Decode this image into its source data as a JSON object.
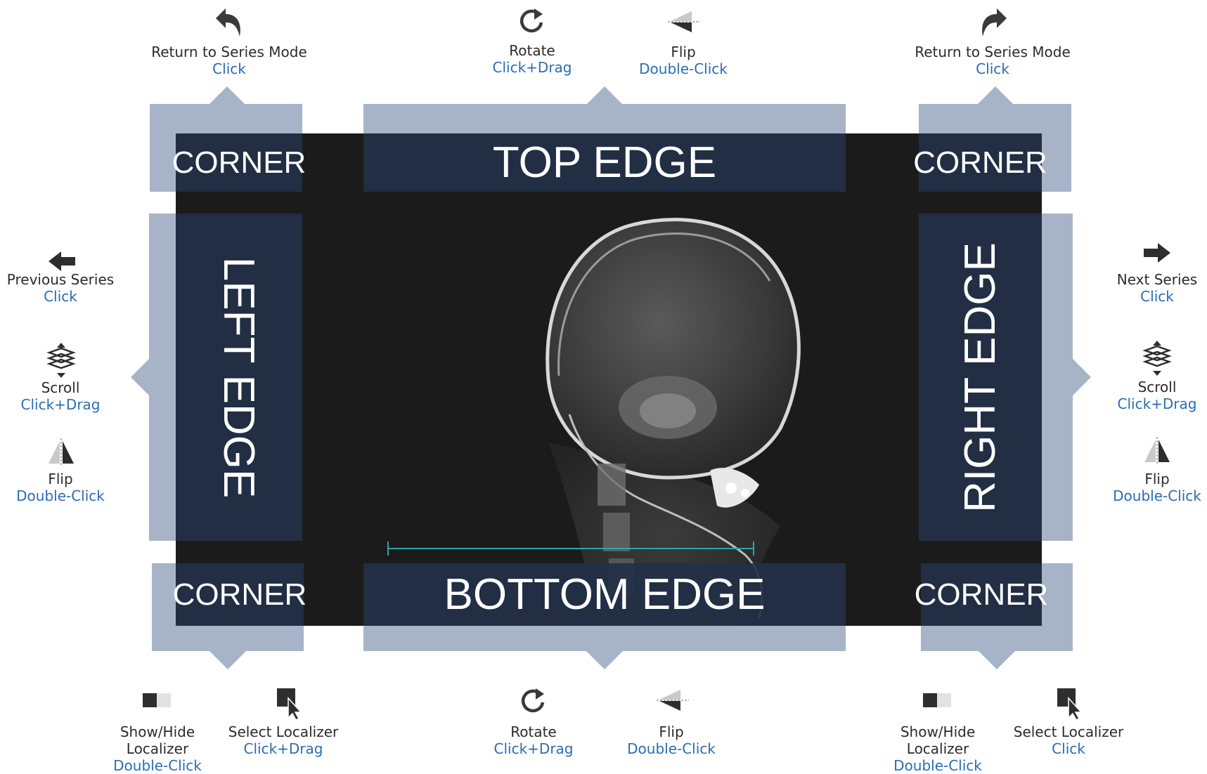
{
  "zones": {
    "top_edge": "TOP EDGE",
    "bottom_edge": "BOTTOM EDGE",
    "left_edge": "LEFT EDGE",
    "right_edge": "RIGHT EDGE",
    "corner_tl": "CORNER",
    "corner_tr": "CORNER",
    "corner_bl": "CORNER",
    "corner_br": "CORNER"
  },
  "labels": {
    "tl_return": {
      "action": "Return to Series Mode",
      "gesture": "Click",
      "icon": "undo-arrow-icon"
    },
    "top_rotate": {
      "action": "Rotate",
      "gesture": "Click+Drag",
      "icon": "rotate-icon"
    },
    "top_flip": {
      "action": "Flip",
      "gesture": "Double-Click",
      "icon": "flip-vertical-icon"
    },
    "tr_return": {
      "action": "Return to Series Mode",
      "gesture": "Click",
      "icon": "redo-arrow-icon"
    },
    "left_prev": {
      "action": "Previous Series",
      "gesture": "Click",
      "icon": "arrow-left-icon"
    },
    "left_scroll": {
      "action": "Scroll",
      "gesture": "Click+Drag",
      "icon": "scroll-stack-icon"
    },
    "left_flip": {
      "action": "Flip",
      "gesture": "Double-Click",
      "icon": "flip-horizontal-icon"
    },
    "right_next": {
      "action": "Next Series",
      "gesture": "Click",
      "icon": "arrow-right-icon"
    },
    "right_scroll": {
      "action": "Scroll",
      "gesture": "Click+Drag",
      "icon": "scroll-stack-icon"
    },
    "right_flip": {
      "action": "Flip",
      "gesture": "Double-Click",
      "icon": "flip-horizontal-icon"
    },
    "bl_showhide": {
      "action_line1": "Show/Hide",
      "action_line2": "Localizer",
      "gesture": "Double-Click",
      "icon": "toggle-localizer-icon"
    },
    "bl_select": {
      "action": "Select Localizer",
      "gesture": "Click+Drag",
      "icon": "select-cursor-icon"
    },
    "bottom_rotate": {
      "action": "Rotate",
      "gesture": "Click+Drag",
      "icon": "rotate-icon"
    },
    "bottom_flip": {
      "action": "Flip",
      "gesture": "Double-Click",
      "icon": "flip-vertical-icon"
    },
    "br_showhide": {
      "action_line1": "Show/Hide",
      "action_line2": "Localizer",
      "gesture": "Double-Click",
      "icon": "toggle-localizer-icon"
    },
    "br_select": {
      "action": "Select Localizer",
      "gesture": "Click",
      "icon": "select-cursor-icon"
    }
  },
  "colors": {
    "frame": "#a7b3c7",
    "zone": "#223046",
    "gesture_text": "#2b6cb5",
    "viewport_bg": "#1b1b1b"
  }
}
